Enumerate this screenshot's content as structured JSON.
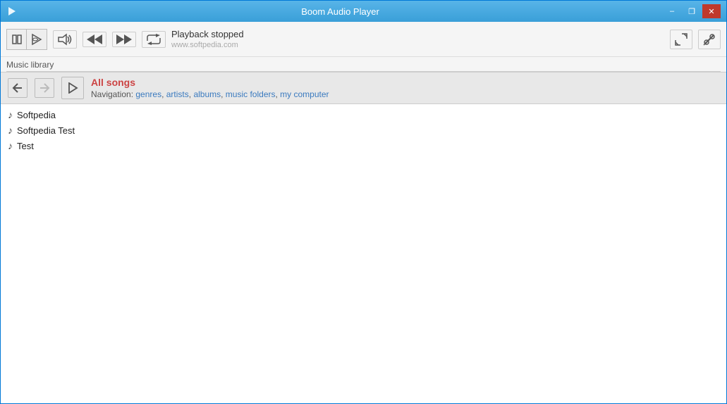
{
  "window": {
    "title": "Boom Audio Player"
  },
  "titlebar": {
    "minimize_label": "–",
    "restore_label": "❐",
    "close_label": "✕"
  },
  "toolbar": {
    "playback_status": "Playback stopped",
    "watermark": "www.softpedia.com"
  },
  "music_library": {
    "label": "Music library"
  },
  "nav": {
    "current_view": "All songs",
    "nav_prefix": "Navigation: ",
    "nav_links": [
      "genres",
      "artists",
      "albums",
      "music folders",
      "my computer"
    ]
  },
  "songs": [
    {
      "name": "Softpedia"
    },
    {
      "name": "Softpedia Test"
    },
    {
      "name": "Test"
    }
  ]
}
